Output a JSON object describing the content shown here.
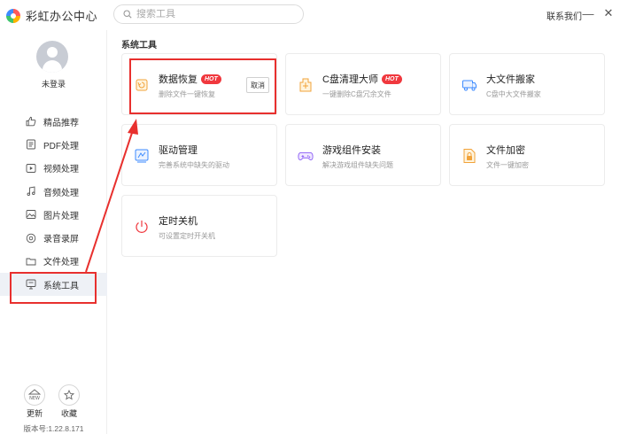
{
  "app": {
    "title": "彩虹办公中心"
  },
  "search": {
    "placeholder": "搜索工具"
  },
  "header": {
    "contact": "联系我们",
    "minimize": "—",
    "close": "✕"
  },
  "user": {
    "login_status": "未登录"
  },
  "sidebar": {
    "items": [
      {
        "label": "精品推荐",
        "icon": "thumbs-up-icon"
      },
      {
        "label": "PDF处理",
        "icon": "pdf-icon"
      },
      {
        "label": "视频处理",
        "icon": "video-icon"
      },
      {
        "label": "音频处理",
        "icon": "music-note-icon"
      },
      {
        "label": "图片处理",
        "icon": "image-icon"
      },
      {
        "label": "录音录屏",
        "icon": "record-icon"
      },
      {
        "label": "文件处理",
        "icon": "folder-icon"
      },
      {
        "label": "系统工具",
        "icon": "monitor-icon",
        "active": true
      }
    ],
    "update_label": "更新",
    "update_badge": "NEW",
    "favorite_label": "收藏",
    "version": "版本号:1.22.8.171"
  },
  "main": {
    "section_title": "系统工具",
    "cards": [
      {
        "title": "数据恢复",
        "hot": "HOT",
        "desc": "删除文件一键恢复",
        "cancel": "取消",
        "icon": "data-recovery-icon"
      },
      {
        "title": "C盘清理大师",
        "hot": "HOT",
        "desc": "一键删除C盘冗余文件",
        "icon": "disk-cleanup-icon"
      },
      {
        "title": "大文件搬家",
        "desc": "C盘中大文件搬家",
        "icon": "file-move-icon"
      },
      {
        "title": "驱动管理",
        "desc": "完善系统中缺失的驱动",
        "icon": "driver-icon"
      },
      {
        "title": "游戏组件安装",
        "desc": "解决游戏组件缺失问题",
        "icon": "gamepad-icon"
      },
      {
        "title": "文件加密",
        "desc": "文件一键加密",
        "icon": "file-lock-icon"
      },
      {
        "title": "定时关机",
        "desc": "可设置定时开关机",
        "icon": "power-icon"
      }
    ]
  },
  "colors": {
    "accent": "#3d8bff",
    "hot": "#f0383e",
    "annotation": "#e8302e"
  }
}
